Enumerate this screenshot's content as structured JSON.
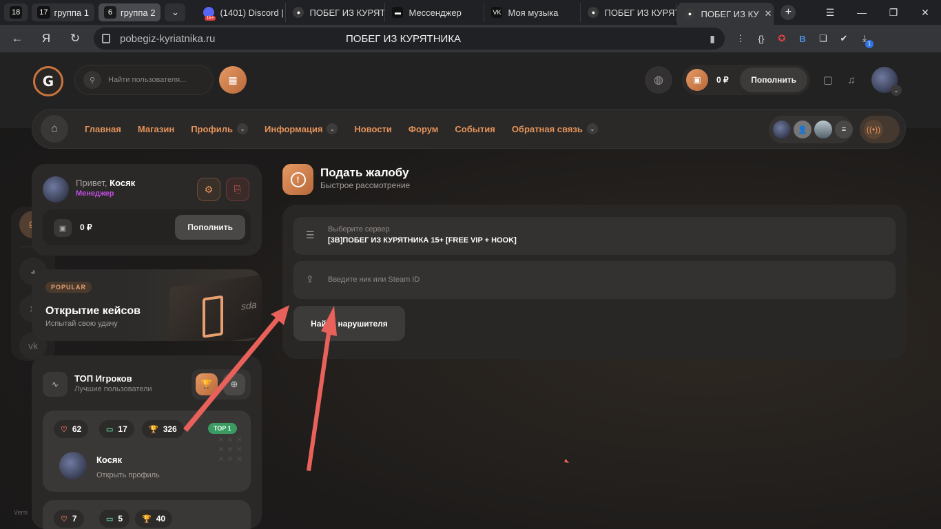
{
  "browser": {
    "groups": [
      {
        "count": "18",
        "label": ""
      },
      {
        "count": "17",
        "label": "группа 1"
      },
      {
        "count": "6",
        "label": "группа 2"
      }
    ],
    "tabs": [
      {
        "title": "(1401) Discord |",
        "icon": "discord-icon",
        "badge": "1k+"
      },
      {
        "title": "ПОБЕГ ИЗ КУРЯТ",
        "icon": "site-favicon"
      },
      {
        "title": "Мессенджер",
        "icon": "messenger-icon"
      },
      {
        "title": "Моя музыка",
        "icon": "vk-icon"
      },
      {
        "title": "ПОБЕГ ИЗ КУРЯТ",
        "icon": "site-favicon"
      },
      {
        "title": "ПОБЕГ ИЗ КУ",
        "icon": "site-favicon"
      }
    ],
    "url": "pobegiz-kyriatnika.ru",
    "page_title": "ПОБЕГ ИЗ КУРЯТНИКА",
    "download_badge": "1"
  },
  "header": {
    "search_placeholder": "Найти пользователя...",
    "balance": "0 ₽",
    "topup_label": "Пополнить"
  },
  "nav": {
    "items": [
      {
        "label": "Главная",
        "dropdown": false
      },
      {
        "label": "Магазин",
        "dropdown": false
      },
      {
        "label": "Профиль",
        "dropdown": true
      },
      {
        "label": "Информация",
        "dropdown": true
      },
      {
        "label": "Новости",
        "dropdown": false
      },
      {
        "label": "Форум",
        "dropdown": false
      },
      {
        "label": "События",
        "dropdown": false
      },
      {
        "label": "Обратная связь",
        "dropdown": true
      }
    ]
  },
  "sidebar": {
    "greeting": "Привет,",
    "username": "Косяк",
    "role": "Менеджер",
    "balance": "0 ₽",
    "topup_label": "Пополнить",
    "cases_badge": "POPULAR",
    "cases_title": "Открытие кейсов",
    "cases_subtitle": "Испытай свою удачу",
    "cases_box_text": "sda",
    "top_title": "ТОП Игроков",
    "top_subtitle": "Лучшие пользователи",
    "players": [
      {
        "likes": "62",
        "comments": "17",
        "trophies": "326",
        "badge": "TOP 1",
        "name": "Косяк",
        "link": "Открыть профиль"
      },
      {
        "likes": "7",
        "comments": "5",
        "trophies": "40"
      }
    ],
    "version": "Versi"
  },
  "complaint": {
    "title": "Подать жалобу",
    "subtitle": "Быстрое рассмотрение",
    "server_label": "Выберите сервер",
    "server_value": "[3B]ПОБЕГ ИЗ КУРЯТНИКА 15+ [FREE VIP + HOOK]",
    "nick_placeholder": "Введите ник или Steam ID",
    "find_button": "Найти нарушителя"
  },
  "colors": {
    "accent": "#e4935a",
    "role": "#c24ee0",
    "arrow": "#e8615a",
    "top_badge": "#3a9a62"
  }
}
